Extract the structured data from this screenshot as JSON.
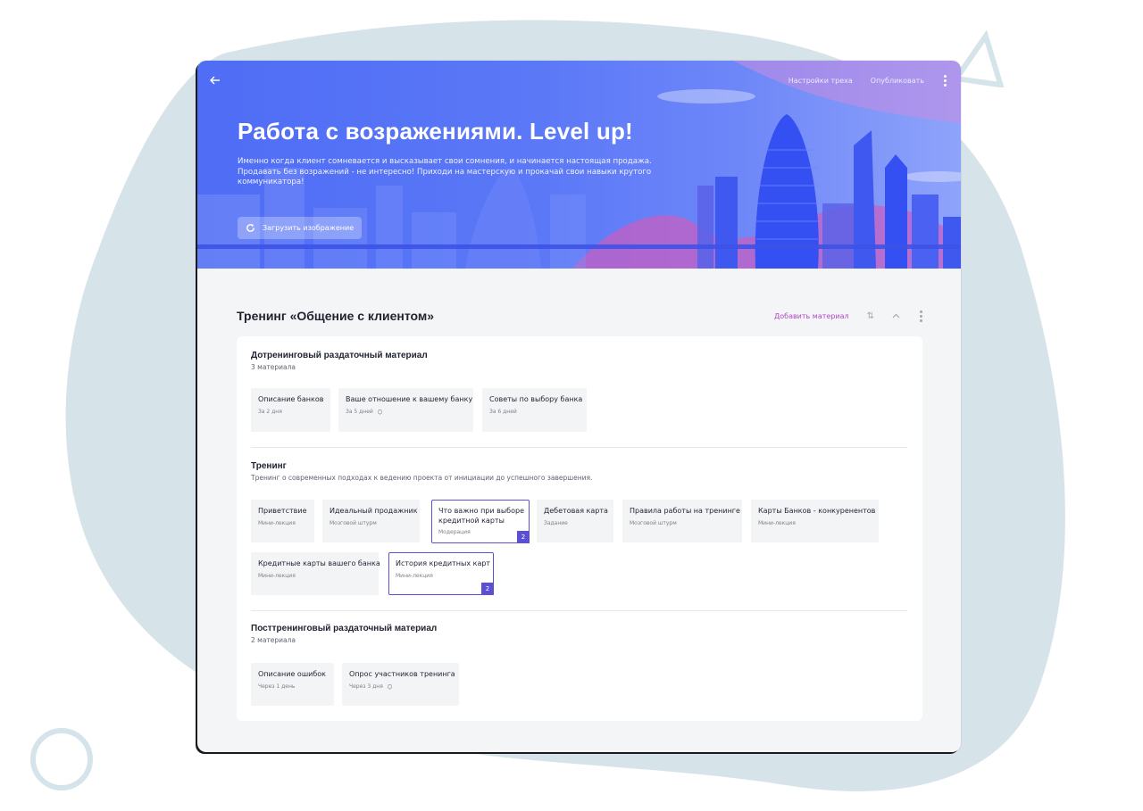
{
  "header": {
    "back_icon": "arrow-left-icon",
    "settings_label": "Настройки треха",
    "publish_label": "Опубликовать",
    "menu_icon": "kebab-icon"
  },
  "hero": {
    "title": "Работа с возражениями. Level up!",
    "description": "Именно когда клиент сомневается и высказывает свои сомнения, и начинается настоящая продажа. Продавать без возражений - не интересно! Приходи на мастерскую и прокачай свои навыки крутого коммуникатора!",
    "upload_label": "Загрузить изображение",
    "upload_icon": "refresh-icon",
    "colors": {
      "primary": "#4f6df5",
      "accent_pink": "#c85ec8"
    }
  },
  "section": {
    "title": "Тренинг «Общение с клиентом»",
    "add_label": "Добавить материал",
    "sort_icon": "sort-icon",
    "collapse_icon": "chevron-up-icon",
    "menu_icon": "kebab-icon",
    "add_color": "#b445c9"
  },
  "groups": [
    {
      "title": "Дотренинговый раздаточный материал",
      "subtitle": "3 материала",
      "items": [
        {
          "title": "Описание банков",
          "sub": "За 2 дня"
        },
        {
          "title": "Ваше отношение к вашему банку",
          "sub": "За 5 дней",
          "bell": true
        },
        {
          "title": "Советы по выбору банка",
          "sub": "За 6 дней"
        }
      ]
    },
    {
      "title": "Тренинг",
      "subtitle": "Тренинг о современных подходах к ведению проекта от инициации до успешного завершения.",
      "items": [
        {
          "title": "Приветствие",
          "sub": "Мини-лекция"
        },
        {
          "title": "Идеальный продажник",
          "sub": "Мозговой штурм"
        },
        {
          "title": "Что важно при выборе",
          "title2": "кредитной карты",
          "sub": "Модерация",
          "badge": "2",
          "selected": true
        },
        {
          "title": "Дебетовая карта",
          "sub": "Задание"
        },
        {
          "title": "Правила работы на тренинге",
          "sub": "Мозговой штурм"
        },
        {
          "title": "Карты Банков - конкуренентов",
          "sub": "Мини-лекция"
        },
        {
          "title": "Кредитные карты вашего банка",
          "sub": "Мини-лекция"
        },
        {
          "title": "История кредитных карт",
          "sub": "Мини-лекция",
          "badge": "2",
          "selected": true
        }
      ]
    },
    {
      "title": "Посттренинговый раздаточный материал",
      "subtitle": "2 материала",
      "items": [
        {
          "title": "Описание ошибок",
          "sub": "Через 1 день"
        },
        {
          "title": "Опрос участников тренинга",
          "sub": "Через 3 дня",
          "bell": true
        }
      ]
    }
  ],
  "selection_color": "#5b4fd6"
}
